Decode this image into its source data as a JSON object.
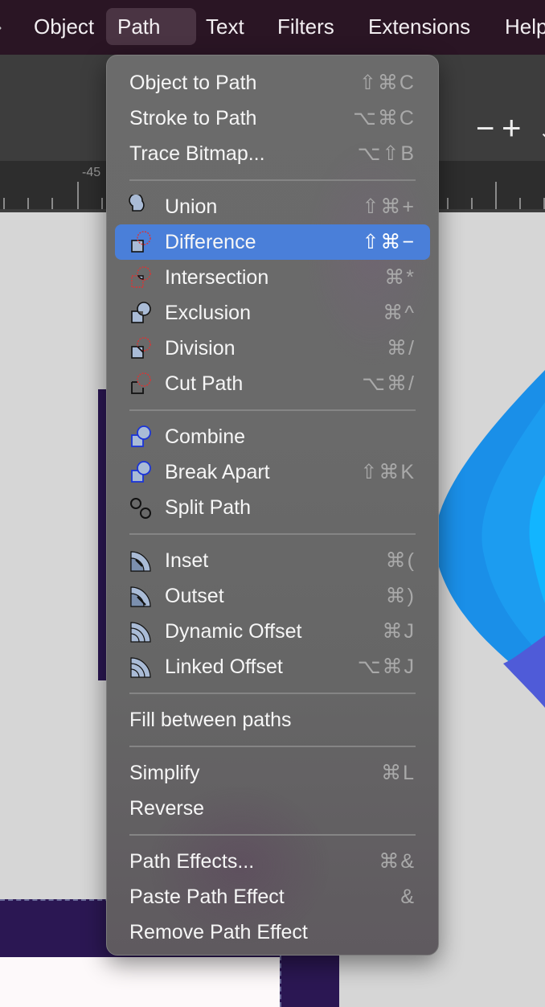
{
  "menubar": {
    "items": [
      "Object",
      "Path",
      "Text",
      "Filters",
      "Extensions",
      "Help"
    ],
    "active": "Path"
  },
  "toolbar": {
    "ruler_label": "-45"
  },
  "menu": {
    "groups": [
      [
        {
          "label": "Object to Path",
          "shortcut": "⇧⌘C"
        },
        {
          "label": "Stroke to Path",
          "shortcut": "⌥⌘C"
        },
        {
          "label": "Trace Bitmap...",
          "shortcut": "⌥⇧B"
        }
      ],
      [
        {
          "label": "Union",
          "shortcut": "⇧⌘+",
          "icon": "union-icon"
        },
        {
          "label": "Difference",
          "shortcut": "⇧⌘−",
          "icon": "difference-icon",
          "selected": true
        },
        {
          "label": "Intersection",
          "shortcut": "⌘*",
          "icon": "intersection-icon"
        },
        {
          "label": "Exclusion",
          "shortcut": "⌘^",
          "icon": "exclusion-icon"
        },
        {
          "label": "Division",
          "shortcut": "⌘/",
          "icon": "division-icon"
        },
        {
          "label": "Cut Path",
          "shortcut": "⌥⌘/",
          "icon": "cut-path-icon"
        }
      ],
      [
        {
          "label": "Combine",
          "shortcut": "",
          "icon": "combine-icon"
        },
        {
          "label": "Break Apart",
          "shortcut": "⇧⌘K",
          "icon": "break-apart-icon"
        },
        {
          "label": "Split Path",
          "shortcut": "",
          "icon": "split-path-icon"
        }
      ],
      [
        {
          "label": "Inset",
          "shortcut": "⌘(",
          "icon": "inset-icon"
        },
        {
          "label": "Outset",
          "shortcut": "⌘)",
          "icon": "outset-icon"
        },
        {
          "label": "Dynamic Offset",
          "shortcut": "⌘J",
          "icon": "dynamic-offset-icon"
        },
        {
          "label": "Linked Offset",
          "shortcut": "⌥⌘J",
          "icon": "linked-offset-icon"
        }
      ],
      [
        {
          "label": "Fill between paths",
          "shortcut": ""
        }
      ],
      [
        {
          "label": "Simplify",
          "shortcut": "⌘L"
        },
        {
          "label": "Reverse",
          "shortcut": ""
        }
      ],
      [
        {
          "label": "Path Effects...",
          "shortcut": "⌘&"
        },
        {
          "label": "Paste Path Effect",
          "shortcut": "&"
        },
        {
          "label": "Remove Path Effect",
          "shortcut": ""
        }
      ]
    ]
  },
  "colors": {
    "menubar_bg": "#2a1524",
    "menu_bg": "#6a6a6a",
    "selection": "#4a7fd9",
    "canvas_bg": "#d6d6d6",
    "shape_dark": "#2b1753",
    "shape_blue": "#1a8fe8"
  }
}
